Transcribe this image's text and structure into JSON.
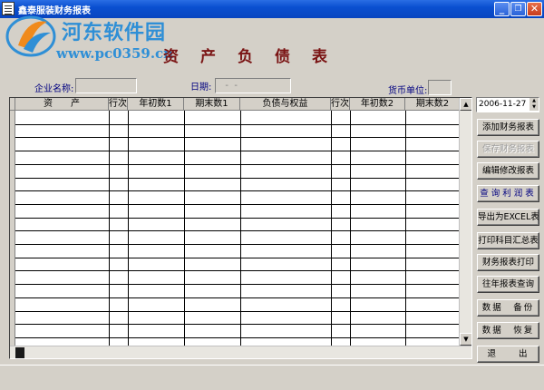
{
  "window": {
    "title": "鑫泰服装财务报表",
    "minimize": "_",
    "restore": "❐",
    "close": "✕"
  },
  "watermark": {
    "site_name": "河东软件园",
    "url": "www.pc0359.cn"
  },
  "report": {
    "title": "资产负债表"
  },
  "fields": {
    "company_label": "企业名称:",
    "company_value": "",
    "date_label": "日期:",
    "date_value": "  -  -",
    "currency_label": "货币单位:",
    "currency_value": ""
  },
  "table": {
    "columns": [
      "资　　产",
      "行次",
      "年初数1",
      "期末数1",
      "负债与权益",
      "行次",
      "年初数2",
      "期末数2"
    ],
    "rows": 18
  },
  "date_picker": {
    "value": "2006-11-27"
  },
  "actions": [
    {
      "id": "add",
      "label": "添加财务报表",
      "enabled": true
    },
    {
      "id": "save",
      "label": "保存财务报表",
      "enabled": false
    },
    {
      "id": "edit",
      "label": "编辑修改报表",
      "enabled": true
    },
    {
      "id": "query-profit",
      "label": "查询利润表",
      "enabled": true
    },
    {
      "id": "export",
      "label": "导出为EXCEL表",
      "enabled": true
    },
    {
      "id": "print-summary",
      "label": "打印科目汇总表",
      "enabled": true
    },
    {
      "id": "print-report",
      "label": "财务报表打印",
      "enabled": true
    },
    {
      "id": "history",
      "label": "往年报表查询",
      "enabled": true
    },
    {
      "id": "backup",
      "label": "数据　备份",
      "enabled": true
    },
    {
      "id": "restore",
      "label": "数据　恢复",
      "enabled": true
    },
    {
      "id": "exit",
      "label": "退　　出",
      "enabled": true
    }
  ],
  "colors": {
    "titlebar": "#0a4fd0",
    "report_title": "#7a1414",
    "watermark": "#2f8fd6",
    "label_text": "#000080"
  }
}
